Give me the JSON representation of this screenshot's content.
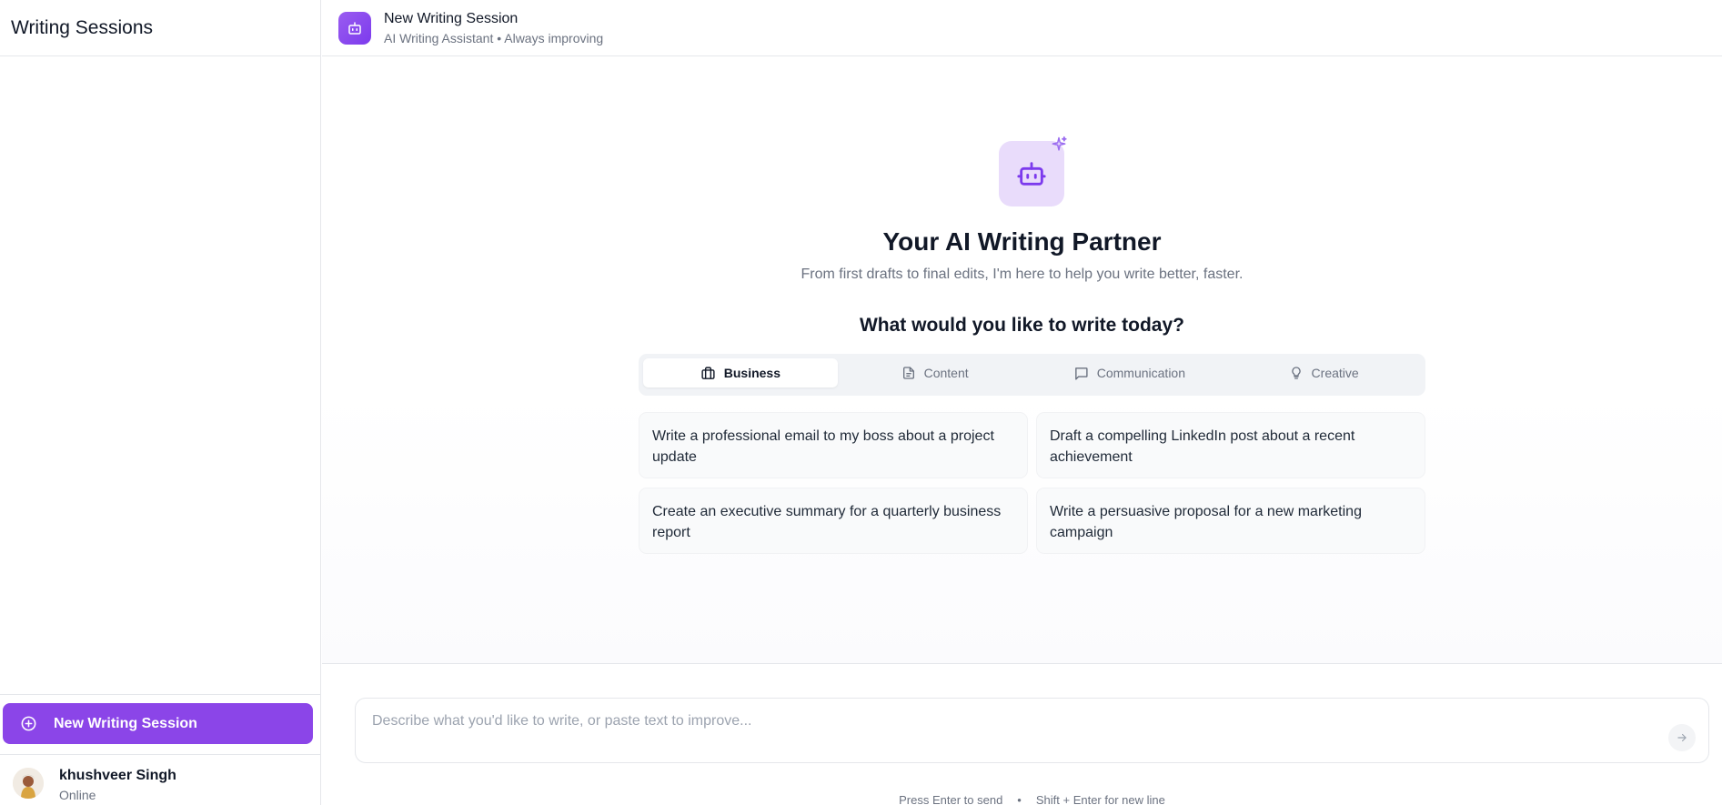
{
  "sidebar": {
    "title": "Writing Sessions",
    "new_session_label": "New Writing Session",
    "user": {
      "name": "khushveer Singh",
      "status": "Online"
    }
  },
  "header": {
    "title": "New Writing Session",
    "subtitle": "AI Writing Assistant • Always improving"
  },
  "main": {
    "hero_title": "Your AI Writing Partner",
    "hero_subtitle": "From first drafts to final edits, I'm here to help you write better, faster.",
    "prompt_question": "What would you like to write today?",
    "tabs": [
      {
        "label": "Business",
        "icon": "briefcase-icon",
        "active": true
      },
      {
        "label": "Content",
        "icon": "document-icon",
        "active": false
      },
      {
        "label": "Communication",
        "icon": "chat-bubble-icon",
        "active": false
      },
      {
        "label": "Creative",
        "icon": "lightbulb-icon",
        "active": false
      }
    ],
    "suggestions": [
      "Write a professional email to my boss about a project update",
      "Draft a compelling LinkedIn post about a recent achievement",
      "Create an executive summary for a quarterly business report",
      "Write a persuasive proposal for a new marketing campaign"
    ]
  },
  "composer": {
    "placeholder": "Describe what you'd like to write, or paste text to improve...",
    "value": "",
    "hint_send": "Press Enter to send",
    "hint_separator": "•",
    "hint_newline": "Shift + Enter for new line"
  },
  "colors": {
    "accent": "#8b45e8",
    "accent_light": "#e9dcfb",
    "text_primary": "#111827",
    "text_muted": "#6b7280"
  }
}
